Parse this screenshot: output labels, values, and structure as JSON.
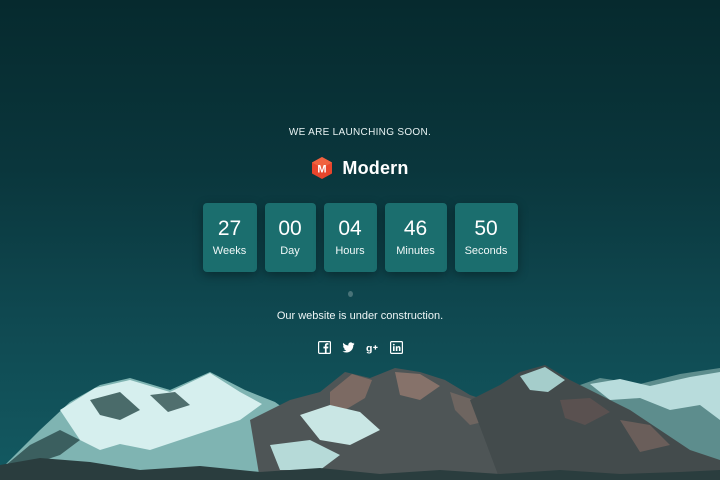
{
  "hero": {
    "tagline": "WE ARE LAUNCHING SOON.",
    "brand_name": "Modern",
    "brand_logo_letter": "M",
    "message": "Our website is under construction."
  },
  "countdown": [
    {
      "value": "27",
      "label": "Weeks"
    },
    {
      "value": "00",
      "label": "Day"
    },
    {
      "value": "04",
      "label": "Hours"
    },
    {
      "value": "46",
      "label": "Minutes"
    },
    {
      "value": "50",
      "label": "Seconds"
    }
  ],
  "social": [
    {
      "icon": "facebook-icon"
    },
    {
      "icon": "twitter-icon"
    },
    {
      "icon": "google-plus-icon"
    },
    {
      "icon": "linkedin-icon"
    }
  ],
  "colors": {
    "background_top": "#062a2e",
    "background_bottom": "#135a62",
    "countdown_box": "#1b6e6e",
    "logo_accent": "#e8452c",
    "text": "#ffffff"
  }
}
